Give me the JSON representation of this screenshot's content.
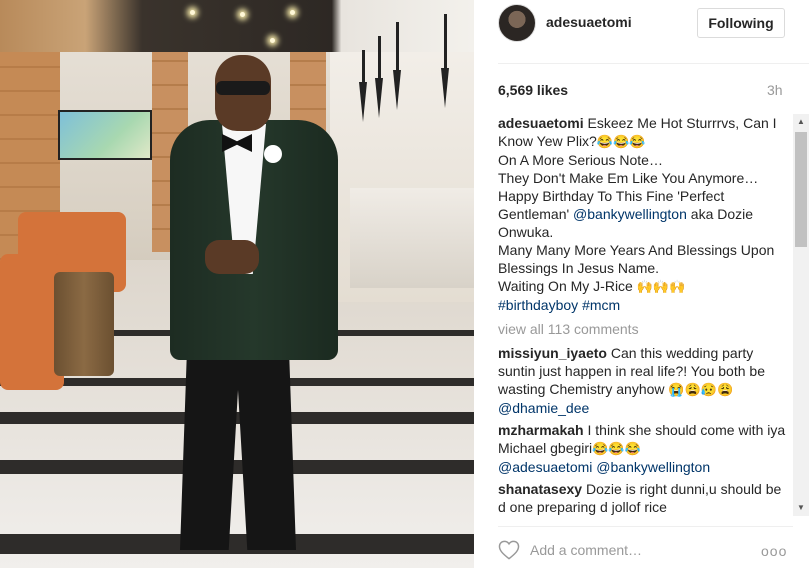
{
  "header": {
    "username": "adesuaetomi",
    "follow_label": "Following"
  },
  "meta": {
    "likes": "6,569 likes",
    "time": "3h"
  },
  "caption": {
    "username": "adesuaetomi",
    "line1": "Eskeez Me Hot Sturrrvs, Can I Know Yew Plix?",
    "line1_emoji": "😂😂😂",
    "line2": "On A More Serious Note…",
    "line3": "They Don't Make Em Like You Anymore… Happy Birthday To This Fine 'Perfect Gentleman' ",
    "mention": "@bankywellington",
    "line4": " aka Dozie Onwuka.",
    "line5": "Many Many More Years And Blessings Upon Blessings In Jesus Name.",
    "line6": "Waiting On My J-Rice",
    "line6_emoji": "🙌🙌🙌",
    "hashtag1": "#birthdayboy",
    "hashtag2": "#mcm"
  },
  "view_all": "view all 113 comments",
  "comments": [
    {
      "user": "missiyun_iyaeto",
      "text": "Can this wedding party suntin just happen in real life?! You both be wasting Chemistry anyhow ",
      "emoji": "😭😩😥😩",
      "mention": "@dhamie_dee"
    },
    {
      "user": "mzharmakah",
      "text": "I think she should come with iya Michael gbegiri",
      "emoji": "😂😂😂",
      "mention1": "@adesuaetomi",
      "mention2": "@bankywellington"
    },
    {
      "user": "shanatasexy",
      "text": "Dozie is right dunni,u should be d one preparing d jollof rice"
    }
  ],
  "footer": {
    "placeholder": "Add a comment…",
    "more": "ooo"
  },
  "icons": {
    "heart": "heart-icon",
    "more": "more-options-icon"
  },
  "colors": {
    "link": "#003569",
    "muted": "#999999",
    "text": "#262626"
  }
}
